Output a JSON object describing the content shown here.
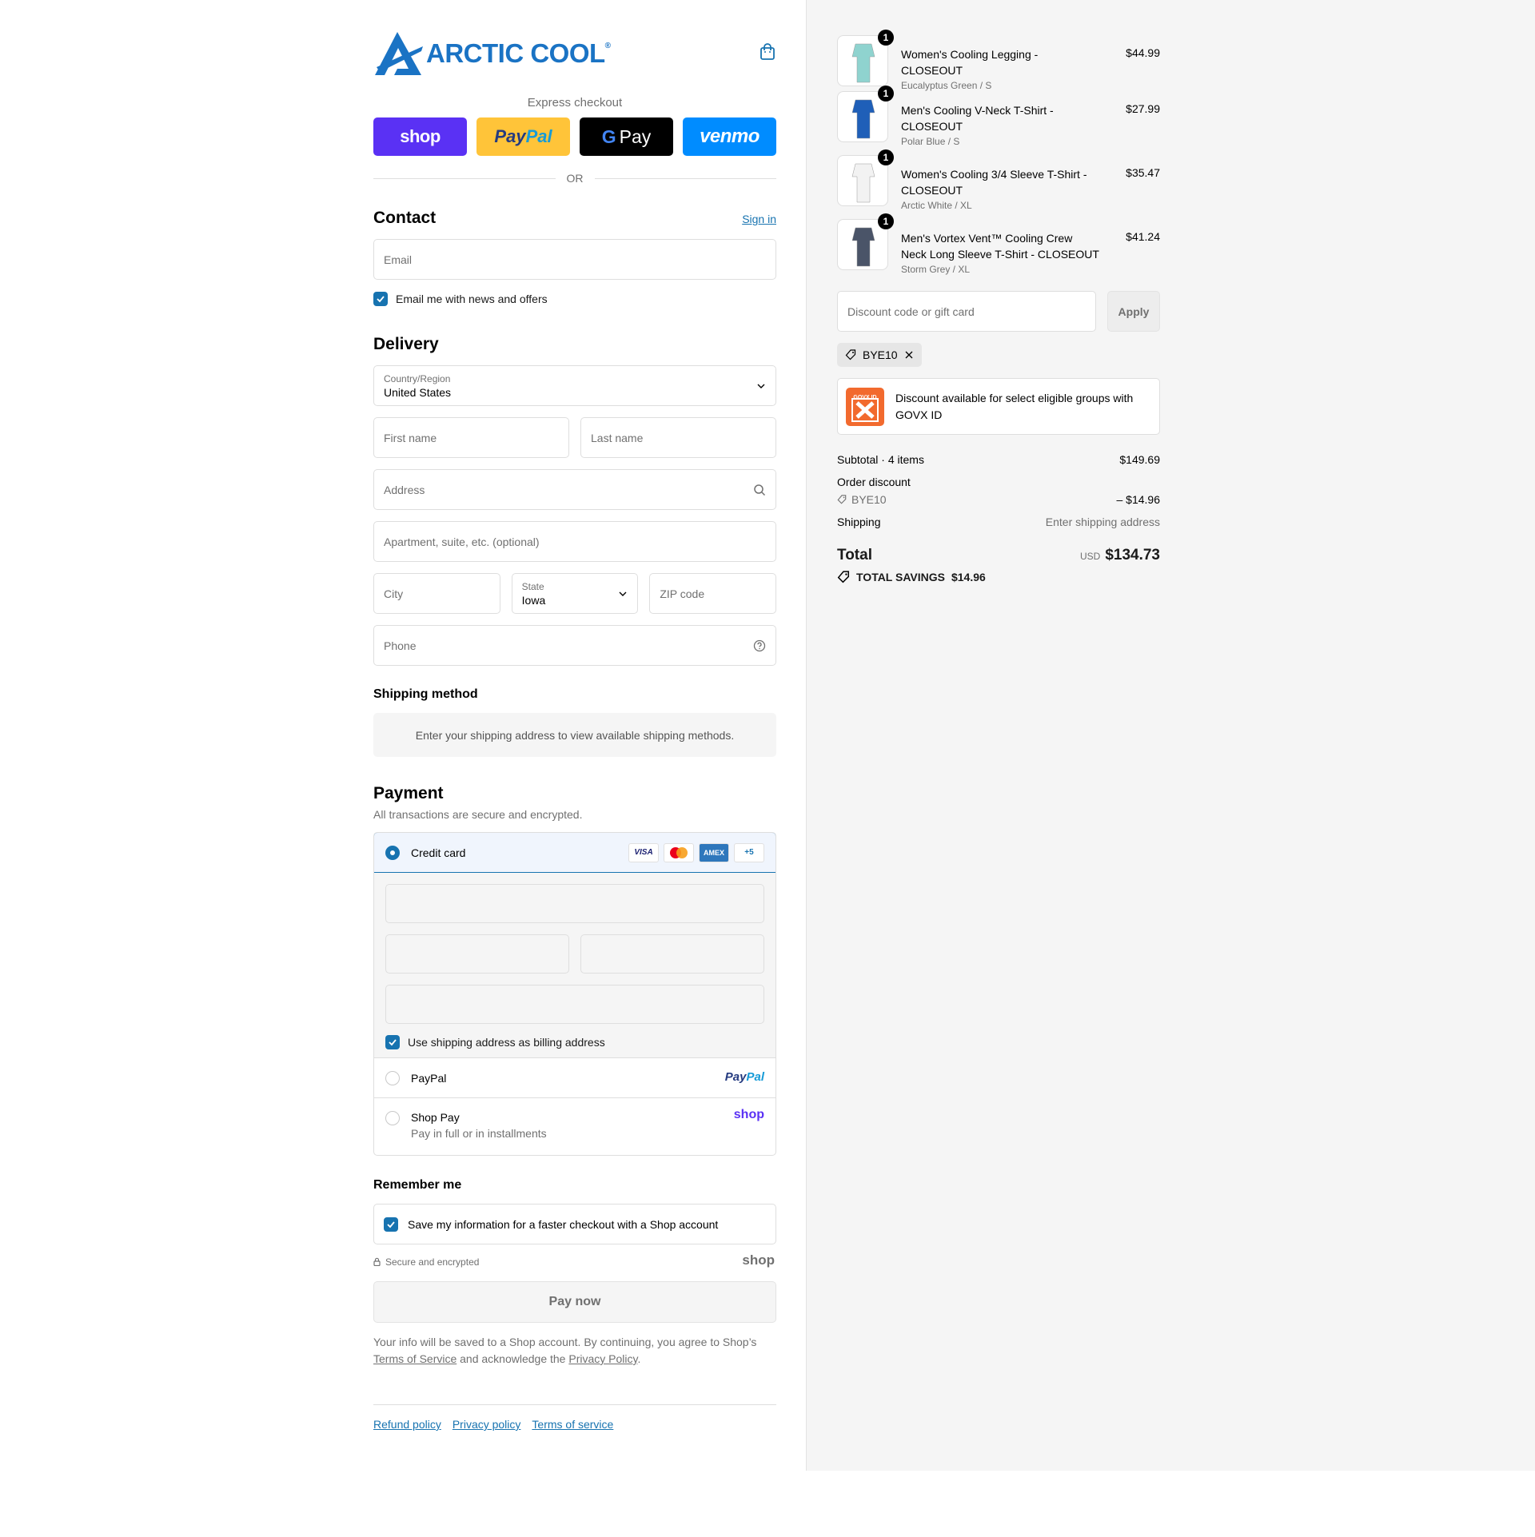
{
  "brand": {
    "name": "ARCTIC COOL",
    "trademark": "®"
  },
  "colors": {
    "accent": "#1773b0",
    "brand": "#1a73c4",
    "shop": "#5a31f4",
    "paypal": "#ffc439",
    "venmo": "#008cff",
    "govx": "#f26a2e"
  },
  "express": {
    "label": "Express checkout",
    "buttons": [
      {
        "id": "shop",
        "label": "shop"
      },
      {
        "id": "paypal",
        "label_a": "Pay",
        "label_b": "Pal"
      },
      {
        "id": "gpay",
        "label_g": "G",
        "label": "Pay"
      },
      {
        "id": "venmo",
        "label": "venmo"
      }
    ],
    "or": "OR"
  },
  "contact": {
    "title": "Contact",
    "sign_in": "Sign in",
    "email_placeholder": "Email",
    "news_label": "Email me with news and offers",
    "news_checked": true
  },
  "delivery": {
    "title": "Delivery",
    "country_label": "Country/Region",
    "country_value": "United States",
    "first_name": "First name",
    "last_name": "Last name",
    "address": "Address",
    "apartment": "Apartment, suite, etc. (optional)",
    "city": "City",
    "state_label": "State",
    "state_value": "Iowa",
    "zip": "ZIP code",
    "phone": "Phone"
  },
  "shipping_method": {
    "title": "Shipping method",
    "notice": "Enter your shipping address to view available shipping methods."
  },
  "payment": {
    "title": "Payment",
    "subtitle": "All transactions are secure and encrypted.",
    "credit_card": "Credit card",
    "card_logos": [
      "VISA",
      "MC",
      "AMEX",
      "+5"
    ],
    "billing_same": "Use shipping address as billing address",
    "paypal": "PayPal",
    "paypal_logo_a": "Pay",
    "paypal_logo_b": "Pal",
    "shop_pay": "Shop Pay",
    "shop_pay_sub": "Pay in full or in installments",
    "shop_logo": "shop"
  },
  "remember": {
    "title": "Remember me",
    "save_label": "Save my information for a faster checkout with a Shop account",
    "secure": "Secure and encrypted",
    "shop_logo": "shop"
  },
  "pay_now": "Pay now",
  "legal": {
    "line1": "Your info will be saved to a Shop account. By continuing, you agree to Shop’s",
    "tos": "Terms of Service",
    "mid": "and acknowledge the",
    "privacy": "Privacy Policy",
    "end": "."
  },
  "footer": {
    "links": [
      "Refund policy",
      "Privacy policy",
      "Terms of service"
    ]
  },
  "cart": {
    "items": [
      {
        "name": "Women's Cooling Legging - CLOSEOUT",
        "variant": "Eucalyptus Green / S",
        "price": "$44.99",
        "qty": "1",
        "swatch": "#8fd3cf"
      },
      {
        "name": "Men's Cooling V-Neck T-Shirt - CLOSEOUT",
        "variant": "Polar Blue / S",
        "price": "$27.99",
        "qty": "1",
        "swatch": "#1f5fb8"
      },
      {
        "name": "Women's Cooling 3/4 Sleeve T-Shirt - CLOSEOUT",
        "variant": "Arctic White / XL",
        "price": "$35.47",
        "qty": "1",
        "swatch": "#f2f2f2"
      },
      {
        "name": "Men's Vortex Vent™ Cooling Crew Neck Long Sleeve T-Shirt - CLOSEOUT",
        "variant": "Storm Grey / XL",
        "price": "$41.24",
        "qty": "1",
        "swatch": "#4a5468"
      }
    ],
    "discount_placeholder": "Discount code or gift card",
    "apply": "Apply",
    "applied_code": "BYE10",
    "govx_text": "Discount available for select eligible groups with GOVX ID",
    "govx_logo_text": "GOVX ID",
    "subtotal_label": "Subtotal · 4 items",
    "subtotal": "$149.69",
    "order_discount_label": "Order discount",
    "discount_code": "BYE10",
    "discount_amount": "– $14.96",
    "shipping_label": "Shipping",
    "shipping_value": "Enter shipping address",
    "total_label": "Total",
    "currency": "USD",
    "total": "$134.73",
    "savings_label": "TOTAL SAVINGS",
    "savings_amount": "$14.96"
  }
}
